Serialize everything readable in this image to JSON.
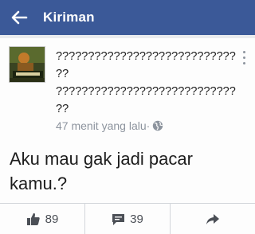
{
  "header": {
    "title": "Kiriman",
    "back_icon": "arrow-left-icon"
  },
  "post": {
    "author_line1": "????????????????????????????",
    "author_line2": "??",
    "author_line3": "????????????????????????????",
    "author_line4": "??",
    "time": "47 menit yang lalu·",
    "privacy_icon": "globe-icon",
    "text": "Aku mau gak jadi pacar kamu.?"
  },
  "actions": {
    "likes": "89",
    "comments": "39",
    "like_icon": "thumbs-up-icon",
    "comment_icon": "comment-icon",
    "share_icon": "share-icon"
  },
  "colors": {
    "brand": "#3b5998",
    "muted": "#8d949e"
  }
}
